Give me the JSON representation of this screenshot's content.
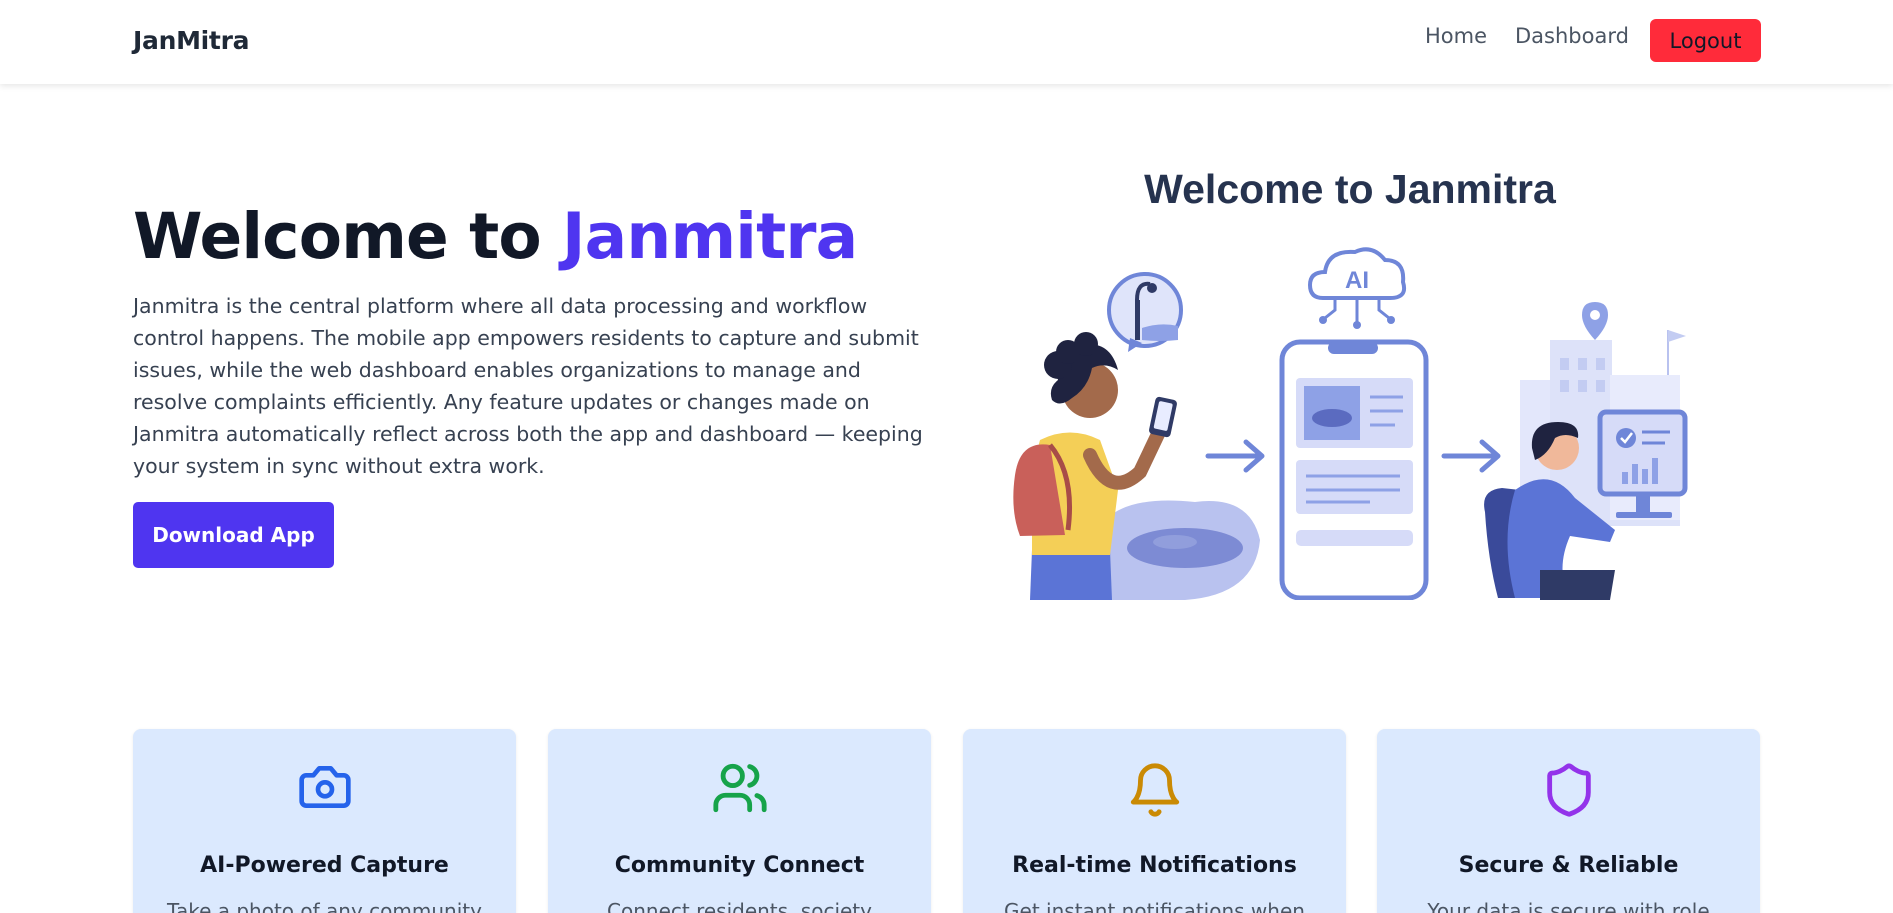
{
  "navbar": {
    "brand": "JanMitra",
    "links": [
      "Home",
      "Dashboard"
    ],
    "logout_label": "Logout"
  },
  "hero": {
    "title_prefix": "Welcome to ",
    "title_accent": "Janmitra",
    "description": "Janmitra is the central platform where all data processing and workflow control happens. The mobile app empowers residents to capture and submit issues, while the web dashboard enables organizations to manage and resolve complaints efficiently. Any feature updates or changes made on Janmitra automatically reflect across both the app and dashboard — keeping your system in sync without extra work.",
    "download_label": "Download App"
  },
  "illustration": {
    "title": "Welcome to Janmitra",
    "badge_text": "AI"
  },
  "features": [
    {
      "icon": "camera-icon",
      "title": "AI-Powered Capture",
      "text": "Take a photo of any community",
      "color": "#2563eb"
    },
    {
      "icon": "users-icon",
      "title": "Community Connect",
      "text": "Connect residents, society",
      "color": "#16a34a"
    },
    {
      "icon": "bell-icon",
      "title": "Real-time Notifications",
      "text": "Get instant notifications when",
      "color": "#ca8a04"
    },
    {
      "icon": "shield-icon",
      "title": "Secure & Reliable",
      "text": "Your data is secure with role",
      "color": "#9333ea"
    }
  ],
  "colors": {
    "accent": "#4f35f0",
    "logout": "#ff2b3a",
    "card_bg": "#dbe9fe"
  }
}
